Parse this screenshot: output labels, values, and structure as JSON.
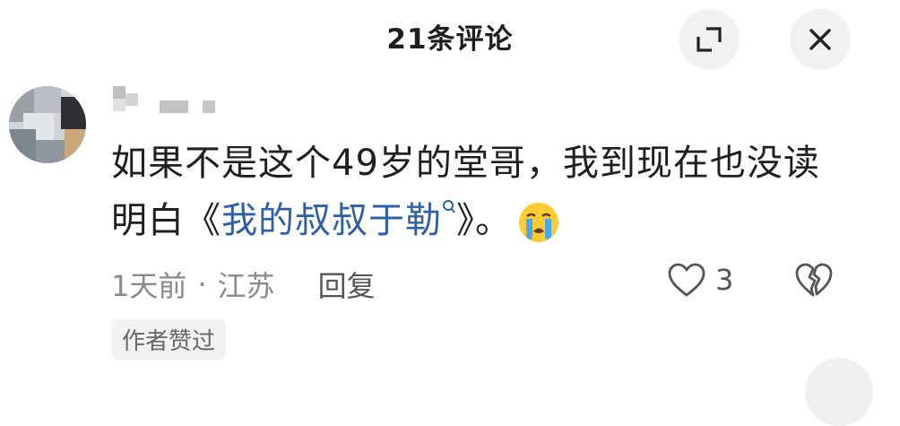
{
  "header": {
    "title": "21条评论",
    "expand_icon": "expand-icon",
    "close_icon": "close-icon"
  },
  "comment": {
    "text_before": "如果不是这个49岁的堂哥，我到现在也没读明白",
    "open_quote": "《",
    "link_text": "我的叔叔于勒",
    "close_quote": "》",
    "text_after": "。",
    "emoji": "crying-face",
    "time": "1天前",
    "separator": "·",
    "location": "江苏",
    "reply_label": "回复",
    "like_count": "3",
    "author_badge": "作者赞过"
  },
  "colors": {
    "link": "#2f5fa4",
    "meta": "#8a8a8a",
    "button_bg": "#f1f1f1"
  }
}
